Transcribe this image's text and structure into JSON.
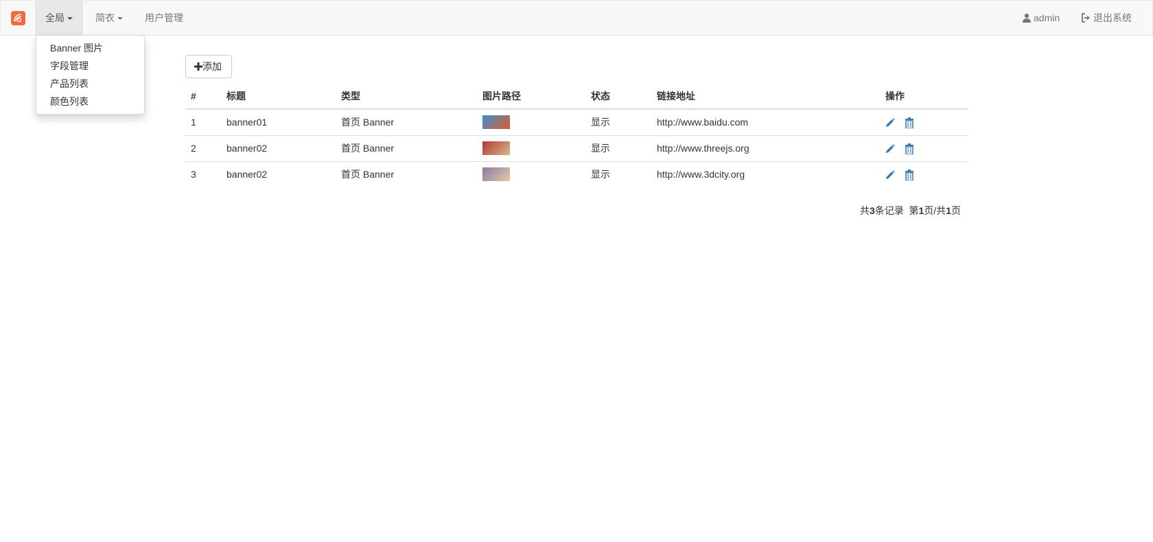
{
  "nav": {
    "items": [
      {
        "label": "全局",
        "active": true,
        "has_caret": true
      },
      {
        "label": "简衣",
        "active": false,
        "has_caret": true
      },
      {
        "label": "用户管理",
        "active": false,
        "has_caret": false
      }
    ],
    "user_label": "admin",
    "logout_label": "退出系统",
    "user_icon": "user-icon",
    "logout_icon": "logout-icon"
  },
  "dropdown": {
    "items": [
      "Banner 图片",
      "字段管理",
      "产品列表",
      "颜色列表"
    ]
  },
  "toolbar": {
    "add_label": "添加",
    "add_icon": "plus-icon"
  },
  "table": {
    "headers": [
      "#",
      "标题",
      "类型",
      "图片路径",
      "状态",
      "链接地址",
      "操作"
    ],
    "rows": [
      {
        "id": "1",
        "title": "banner01",
        "type": "首页 Banner",
        "status": "显示",
        "link": "http://www.baidu.com",
        "thumb_colors": [
          "#3a8fd0",
          "#e05a2a"
        ]
      },
      {
        "id": "2",
        "title": "banner02",
        "type": "首页 Banner",
        "status": "显示",
        "link": "http://www.threejs.org",
        "thumb_colors": [
          "#b03a2e",
          "#d8b890"
        ]
      },
      {
        "id": "3",
        "title": "banner02",
        "type": "首页 Banner",
        "status": "显示",
        "link": "http://www.3dcity.org",
        "thumb_colors": [
          "#8a7aa8",
          "#e8c8a0"
        ]
      }
    ],
    "action_icons": [
      "edit-icon",
      "trash-icon"
    ]
  },
  "pager": {
    "total_prefix": "共",
    "total": "3",
    "total_suffix": "条记录",
    "page_prefix": "第",
    "page": "1",
    "page_mid": "页/共",
    "pages": "1",
    "page_suffix": "页"
  },
  "colors": {
    "brand": "#f26b38",
    "icon_blue": "#337ab7"
  }
}
